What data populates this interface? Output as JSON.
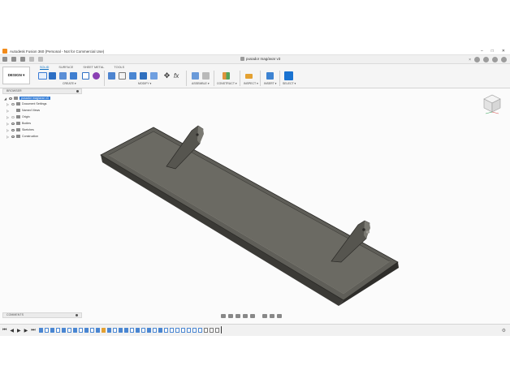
{
  "window": {
    "title": "Autodesk Fusion 360 (Personal - Not for Commercial Use)",
    "controls": [
      "–",
      "□",
      "✕"
    ]
  },
  "tabbar": {
    "doc_title": "pusador mag/avar v3",
    "close": "×"
  },
  "ribbon": {
    "workspace": "DESIGN ▾",
    "tabs": [
      "SOLID",
      "SURFACE",
      "SHEET METAL",
      "TOOLS"
    ],
    "active_tab": "SOLID",
    "groups": [
      "CREATE ▾",
      "MODIFY ▾",
      "ASSEMBLE ▾",
      "CONSTRUCT ▾",
      "INSPECT ▾",
      "INSERT ▾",
      "SELECT ▾"
    ],
    "fx": "fx"
  },
  "browser": {
    "header": "BROWSER",
    "items": [
      {
        "label": "pusador mag/avar v3",
        "selected": true
      },
      {
        "label": "Document Settings"
      },
      {
        "label": "Named Views"
      },
      {
        "label": "Origin"
      },
      {
        "label": "Bodies"
      },
      {
        "label": "Sketches"
      },
      {
        "label": "Construction"
      }
    ]
  },
  "comments": {
    "label": "COMMENTS"
  },
  "colors": {
    "accent": "#0c6fc1",
    "model": "#66655f",
    "model_dark": "#3f3e3a"
  }
}
